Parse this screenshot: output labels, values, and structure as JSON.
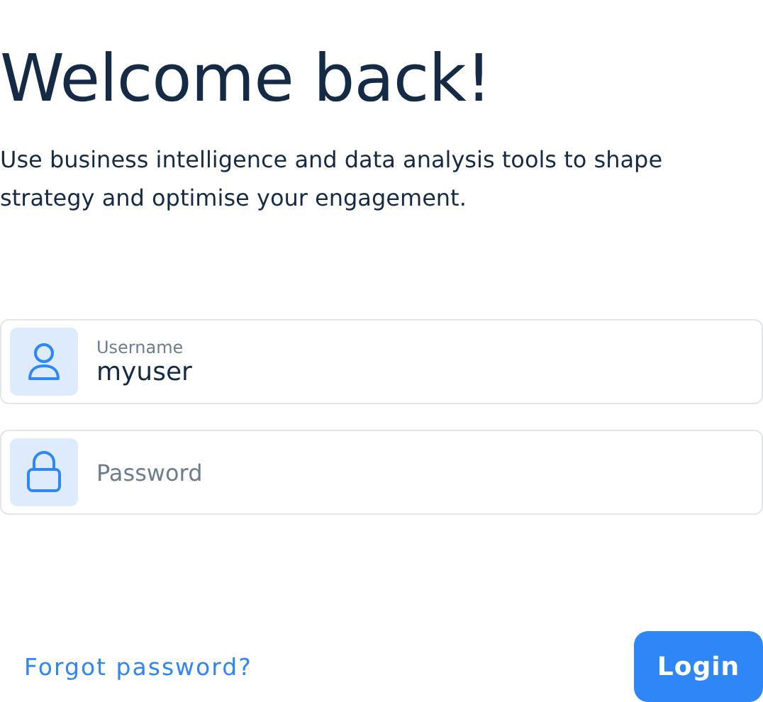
{
  "title": "Welcome back!",
  "subtitle": "Use business intelligence and data analysis tools to shape strategy and optimise your engagement.",
  "fields": [
    {
      "kind": "user",
      "label": "Username",
      "value": "myuser"
    },
    {
      "kind": "lock",
      "placeholder": "Password"
    }
  ],
  "forgot_link": "Forgot password?",
  "login_button": "Login"
}
